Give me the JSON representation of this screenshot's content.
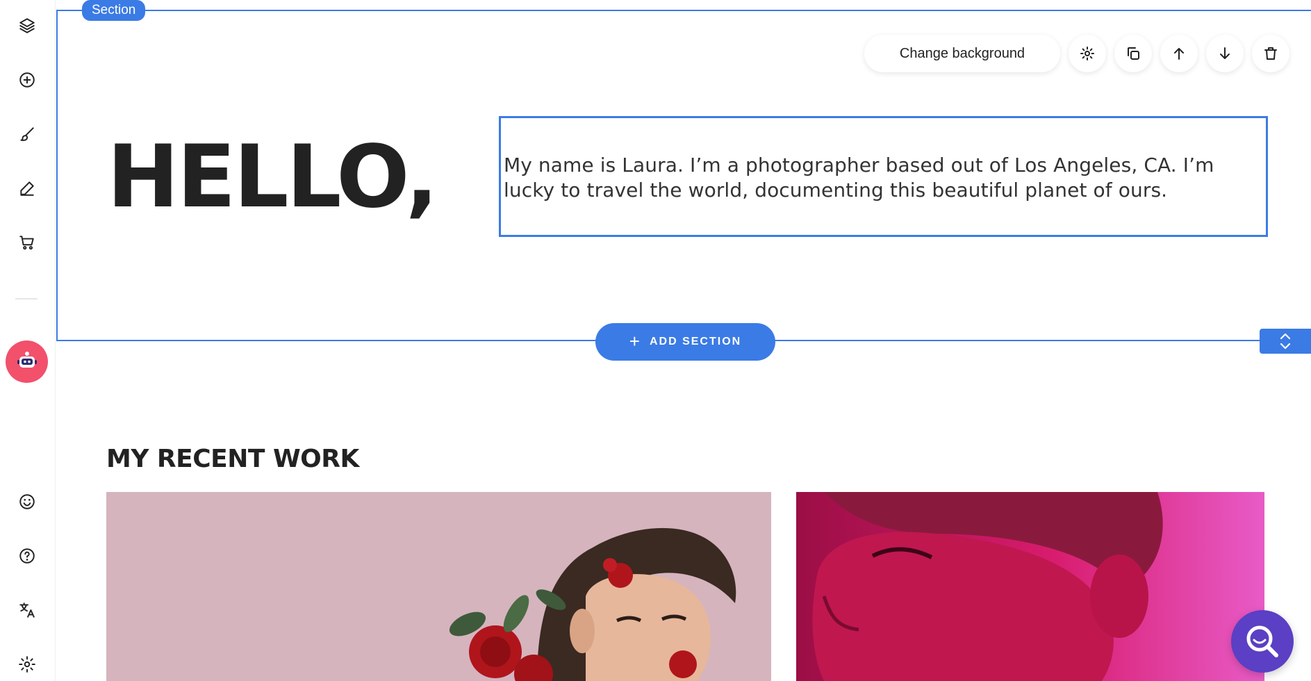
{
  "sidebar": {
    "top_icons": [
      "layers-icon",
      "add-circle-icon",
      "brush-icon",
      "pen-icon",
      "cart-icon"
    ],
    "bottom_icons": [
      "smiley-icon",
      "help-icon",
      "translate-icon",
      "settings-icon"
    ]
  },
  "section": {
    "tag_label": "Section",
    "toolbar": {
      "change_background_label": "Change background",
      "actions": [
        "settings-icon",
        "duplicate-icon",
        "move-up-icon",
        "move-down-icon",
        "delete-icon"
      ]
    },
    "heading": "HELLO,",
    "body_text": "My name is Laura. I’m a photographer based out of Los Angeles, CA. I’m lucky to travel the world, documenting this beautiful planet of ours."
  },
  "add_section": {
    "plus": "+",
    "label": "ADD SECTION"
  },
  "recent_work": {
    "title": "MY RECENT WORK"
  },
  "colors": {
    "accent": "#3b7be5",
    "robot_bg": "#f2506b",
    "search_fab": "#5b3fc4",
    "photo1_bg": "#d5b4be",
    "photo2_bg": "#d91e7a"
  }
}
